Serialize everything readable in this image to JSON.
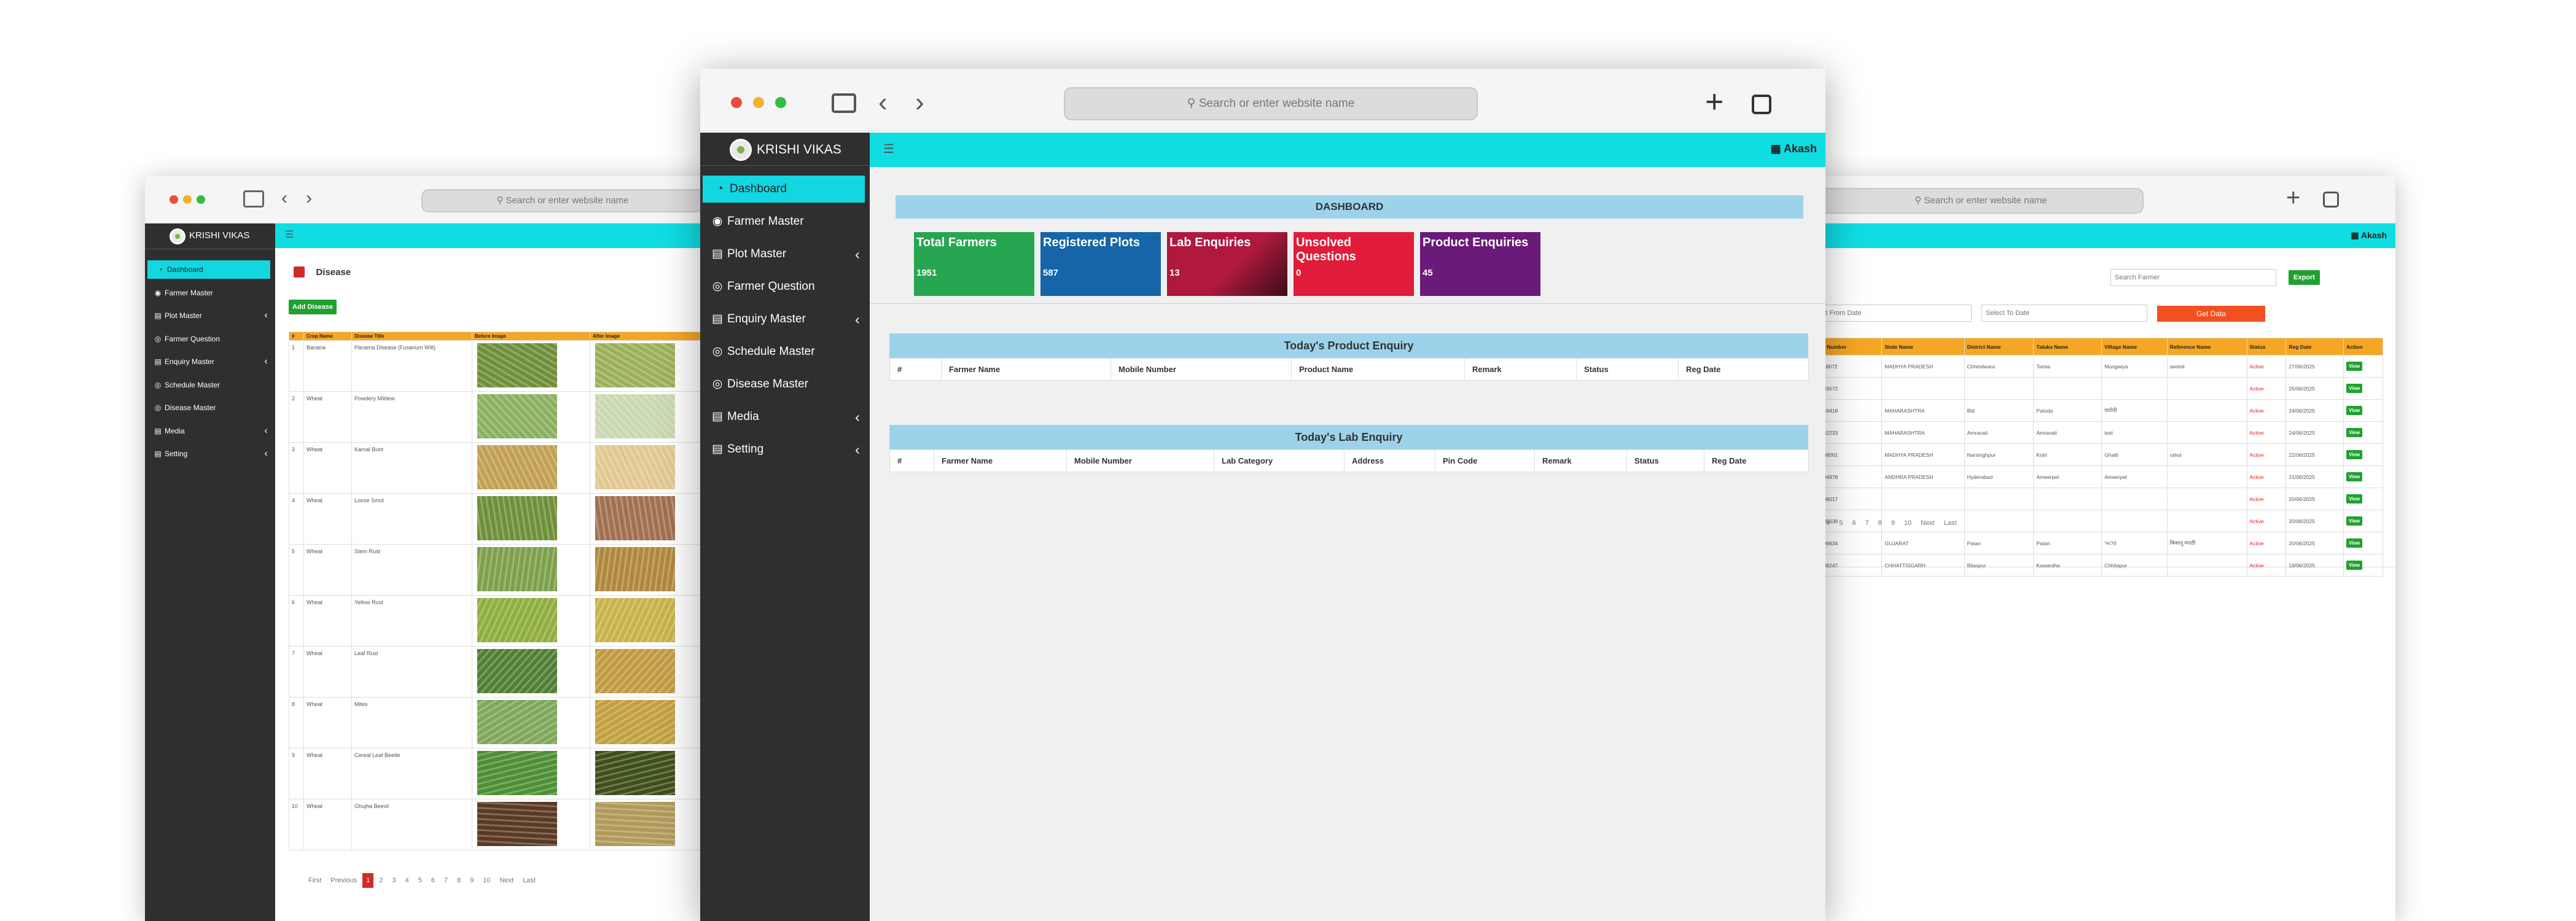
{
  "brand": "KRISHI VIKAS",
  "url_placeholder": "Search or enter website name",
  "url_left_text": "Search or enter website name",
  "user": "Akash",
  "nav": [
    {
      "label": "Dashboard",
      "icon": "dashboard-icon"
    },
    {
      "label": "Farmer Master",
      "icon": "user-icon"
    },
    {
      "label": "Plot Master",
      "icon": "files-icon",
      "arrow": true
    },
    {
      "label": "Farmer Question",
      "icon": "globe-icon"
    },
    {
      "label": "Enquiry Master",
      "icon": "files-icon",
      "arrow": true
    },
    {
      "label": "Schedule Master",
      "icon": "globe-icon"
    },
    {
      "label": "Disease Master",
      "icon": "globe-icon"
    },
    {
      "label": "Media",
      "icon": "files-icon",
      "arrow": true
    },
    {
      "label": "Setting",
      "icon": "files-icon",
      "arrow": true
    }
  ],
  "center": {
    "dashboard_title": "DASHBOARD",
    "cards": [
      {
        "label": "Total Farmers",
        "value": "1951",
        "color": "#27a652"
      },
      {
        "label": "Registered Plots",
        "value": "587",
        "color": "#1565a8"
      },
      {
        "label": "Lab Enquiries",
        "value": "13",
        "color": "#b0183e"
      },
      {
        "label": "Unsolved Questions",
        "value": "0",
        "color": "#e01c3a"
      },
      {
        "label": "Product Enquiries",
        "value": "45",
        "color": "#6a1a78"
      }
    ],
    "product_title": "Today's Product Enquiry",
    "product_cols": [
      "#",
      "Farmer Name",
      "Mobile Number",
      "Product Name",
      "Remark",
      "Status",
      "Reg Date"
    ],
    "lab_title": "Today's Lab Enquiry",
    "lab_cols": [
      "#",
      "Farmer Name",
      "Mobile Number",
      "Lab Category",
      "Address",
      "Pin Code",
      "Remark",
      "Status",
      "Reg Date"
    ]
  },
  "left": {
    "page_title": "Disease",
    "add_button": "Add Disease",
    "cols": [
      "#",
      "Crop Name",
      "Disease Title",
      "Before Image",
      "After Image"
    ],
    "rows": [
      {
        "n": "1",
        "crop": "Banana",
        "title": "Panama Disease (Fusarium Wilt)"
      },
      {
        "n": "2",
        "crop": "Wheat",
        "title": "Powdery Mildew"
      },
      {
        "n": "3",
        "crop": "Wheat",
        "title": "Karnal Bunt"
      },
      {
        "n": "4",
        "crop": "Wheat",
        "title": "Loose Smut"
      },
      {
        "n": "5",
        "crop": "Wheat",
        "title": "Stem Rust"
      },
      {
        "n": "6",
        "crop": "Wheat",
        "title": "Yellow Rust"
      },
      {
        "n": "7",
        "crop": "Wheat",
        "title": "Leaf Rust"
      },
      {
        "n": "8",
        "crop": "Wheat",
        "title": "Mites"
      },
      {
        "n": "9",
        "crop": "Wheat",
        "title": "Cereal Leaf Beetle"
      },
      {
        "n": "10",
        "crop": "Wheat",
        "title": "Ghujha Beevil"
      }
    ],
    "pagination": [
      "First",
      "Previous",
      "1",
      "2",
      "3",
      "4",
      "5",
      "6",
      "7",
      "8",
      "9",
      "10",
      "Next",
      "Last"
    ]
  },
  "right": {
    "search_placeholder": "Search Farmer",
    "export": "Export",
    "from_placeholder": "Select From Date",
    "to_placeholder": "Select To Date",
    "get_data": "Get Data",
    "cols": [
      "Mobile Number",
      "State Name",
      "District Name",
      "Taluka Name",
      "Village Name",
      "Reference Name",
      "Status",
      "Reg Date",
      "Action"
    ],
    "rows": [
      {
        "mobile": "9907118072",
        "state": "MADHYA PRADESH",
        "district": "Chhindwara",
        "taluka": "Tamia",
        "village": "Mungwiya",
        "ref": "seeloli",
        "status": "Active",
        "date": "27/06/2025"
      },
      {
        "mobile": "8290003572",
        "state": "",
        "district": "",
        "taluka": "",
        "village": "",
        "ref": "",
        "status": "Active",
        "date": "25/06/2025"
      },
      {
        "mobile": "7517959418",
        "state": "MAHARASHTRA",
        "district": "Bid",
        "taluka": "Patoda",
        "village": "पाटोदी",
        "ref": "",
        "status": "Active",
        "date": "24/06/2025"
      },
      {
        "mobile": "9730232233",
        "state": "MAHARASHTRA",
        "district": "Amravati",
        "taluka": "Amravati",
        "village": "test",
        "ref": "",
        "status": "Active",
        "date": "24/06/2025"
      },
      {
        "mobile": "8754438001",
        "state": "MADHYA PRADESH",
        "district": "Narsinghpur",
        "taluka": "Kotri",
        "village": "Ghatti",
        "ref": "rahul",
        "status": "Active",
        "date": "22/06/2025"
      },
      {
        "mobile": "9621384978",
        "state": "ANDHRA PRADESH",
        "district": "Hyderabad",
        "taluka": "Ameerpet",
        "village": "Ameerpet",
        "ref": "",
        "status": "Active",
        "date": "21/06/2025"
      },
      {
        "mobile": "7477638017",
        "state": "",
        "district": "",
        "taluka": "",
        "village": "",
        "ref": "",
        "status": "Active",
        "date": "20/06/2025"
      },
      {
        "mobile": "9737385638",
        "state": "",
        "district": "",
        "taluka": "",
        "village": "",
        "ref": "",
        "status": "Active",
        "date": "20/06/2025"
      },
      {
        "mobile": "7283598634",
        "state": "GUJARAT",
        "district": "Patan",
        "taluka": "Patan",
        "village": "પાટણ",
        "ref": "किसानू मराठी",
        "status": "Active",
        "date": "20/06/2025"
      },
      {
        "mobile": "8889008247",
        "state": "CHHATTISGARH",
        "district": "Bilaspur",
        "taluka": "Kawardha",
        "village": "Chhitapur",
        "ref": "",
        "status": "Active",
        "date": "19/06/2025"
      }
    ],
    "view": "View",
    "pagination": [
      "3",
      "4",
      "5",
      "6",
      "7",
      "8",
      "9",
      "10",
      "Next",
      "Last"
    ]
  }
}
